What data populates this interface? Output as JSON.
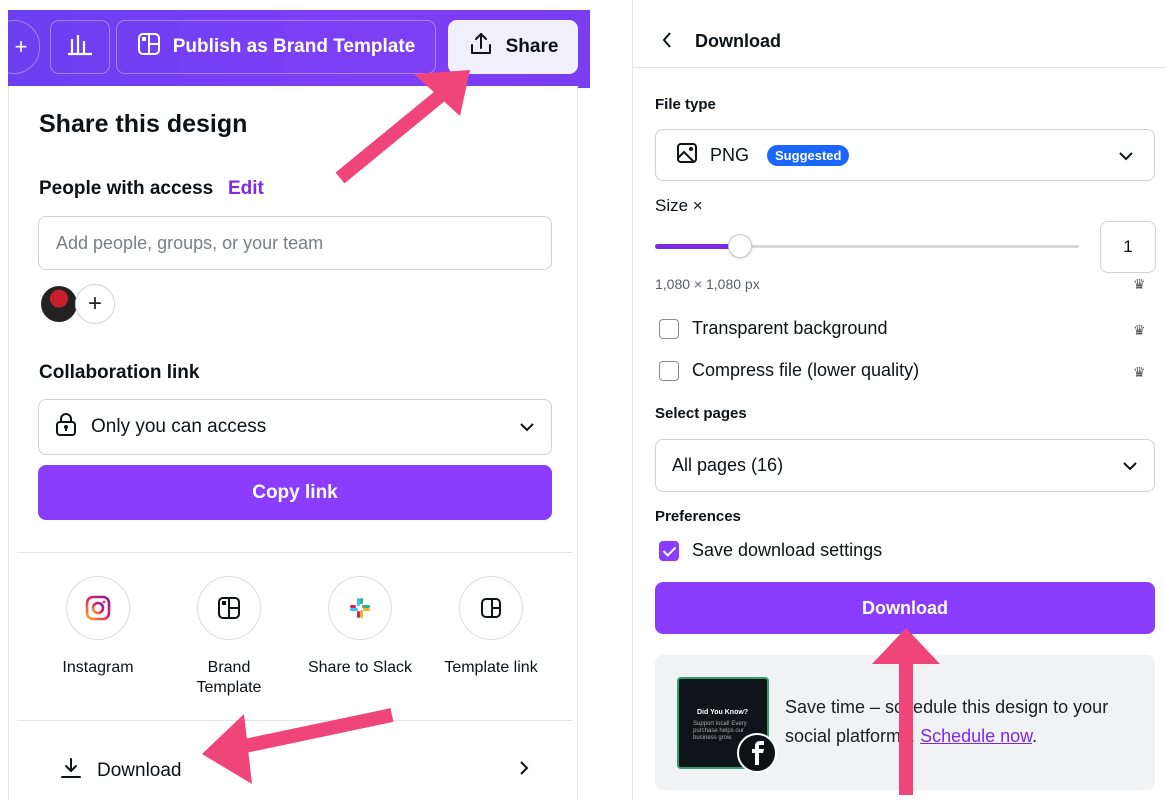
{
  "toolbar": {
    "plus_label": "+",
    "publish_label": "Publish as Brand Template",
    "share_label": "Share"
  },
  "share_panel": {
    "title": "Share this design",
    "people_label": "People with access",
    "edit_label": "Edit",
    "add_placeholder": "Add people, groups, or your team",
    "avatar_add": "+",
    "collab_label": "Collaboration link",
    "collab_value": "Only you can access",
    "copy_link_label": "Copy link",
    "options": [
      {
        "label": "Instagram",
        "icon": "instagram-icon"
      },
      {
        "label": "Brand\nTemplate",
        "icon": "brand-template-icon"
      },
      {
        "label": "Share to Slack",
        "icon": "slack-icon"
      },
      {
        "label": "Template link",
        "icon": "template-link-icon"
      }
    ],
    "download_label": "Download"
  },
  "download_panel": {
    "title": "Download",
    "file_type_label": "File type",
    "file_type_value": "PNG",
    "suggested_badge": "Suggested",
    "size_label": "Size ×",
    "size_value": "1",
    "size_fraction": 0.2,
    "size_px": "1,080 × 1,080 px",
    "transparent_label": "Transparent background",
    "transparent_checked": false,
    "compress_label": "Compress file (lower quality)",
    "compress_checked": false,
    "pages_label": "Select pages",
    "pages_value": "All pages (16)",
    "preferences_label": "Preferences",
    "save_settings_label": "Save download settings",
    "save_settings_checked": true,
    "download_button": "Download",
    "promo_text": "Save time – schedule this design to your social platforms.",
    "promo_link": "Schedule now",
    "promo_link_suffix": ".",
    "promo_thumb_title": "Did You Know?",
    "promo_thumb_body": "Support local! Every purchase helps our business grow."
  },
  "colors": {
    "accent": "#8b3dff",
    "link": "#7d2ae8",
    "badge": "#1a66ff",
    "toolbar": "#7d3ff5",
    "arrow": "#f0457a"
  }
}
